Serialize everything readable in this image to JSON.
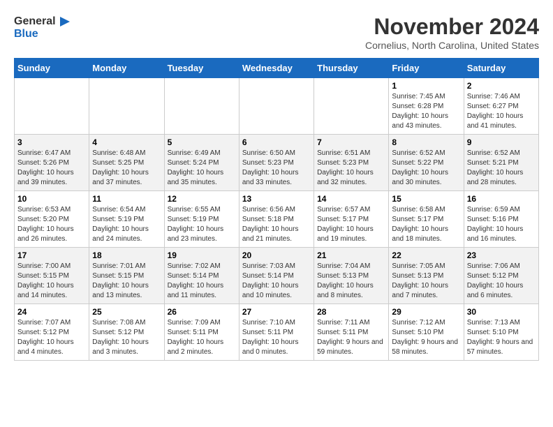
{
  "header": {
    "logo_line1": "General",
    "logo_line2": "Blue",
    "month": "November 2024",
    "location": "Cornelius, North Carolina, United States"
  },
  "days_of_week": [
    "Sunday",
    "Monday",
    "Tuesday",
    "Wednesday",
    "Thursday",
    "Friday",
    "Saturday"
  ],
  "weeks": [
    [
      {
        "day": "",
        "info": ""
      },
      {
        "day": "",
        "info": ""
      },
      {
        "day": "",
        "info": ""
      },
      {
        "day": "",
        "info": ""
      },
      {
        "day": "",
        "info": ""
      },
      {
        "day": "1",
        "info": "Sunrise: 7:45 AM\nSunset: 6:28 PM\nDaylight: 10 hours and 43 minutes."
      },
      {
        "day": "2",
        "info": "Sunrise: 7:46 AM\nSunset: 6:27 PM\nDaylight: 10 hours and 41 minutes."
      }
    ],
    [
      {
        "day": "3",
        "info": "Sunrise: 6:47 AM\nSunset: 5:26 PM\nDaylight: 10 hours and 39 minutes."
      },
      {
        "day": "4",
        "info": "Sunrise: 6:48 AM\nSunset: 5:25 PM\nDaylight: 10 hours and 37 minutes."
      },
      {
        "day": "5",
        "info": "Sunrise: 6:49 AM\nSunset: 5:24 PM\nDaylight: 10 hours and 35 minutes."
      },
      {
        "day": "6",
        "info": "Sunrise: 6:50 AM\nSunset: 5:23 PM\nDaylight: 10 hours and 33 minutes."
      },
      {
        "day": "7",
        "info": "Sunrise: 6:51 AM\nSunset: 5:23 PM\nDaylight: 10 hours and 32 minutes."
      },
      {
        "day": "8",
        "info": "Sunrise: 6:52 AM\nSunset: 5:22 PM\nDaylight: 10 hours and 30 minutes."
      },
      {
        "day": "9",
        "info": "Sunrise: 6:52 AM\nSunset: 5:21 PM\nDaylight: 10 hours and 28 minutes."
      }
    ],
    [
      {
        "day": "10",
        "info": "Sunrise: 6:53 AM\nSunset: 5:20 PM\nDaylight: 10 hours and 26 minutes."
      },
      {
        "day": "11",
        "info": "Sunrise: 6:54 AM\nSunset: 5:19 PM\nDaylight: 10 hours and 24 minutes."
      },
      {
        "day": "12",
        "info": "Sunrise: 6:55 AM\nSunset: 5:19 PM\nDaylight: 10 hours and 23 minutes."
      },
      {
        "day": "13",
        "info": "Sunrise: 6:56 AM\nSunset: 5:18 PM\nDaylight: 10 hours and 21 minutes."
      },
      {
        "day": "14",
        "info": "Sunrise: 6:57 AM\nSunset: 5:17 PM\nDaylight: 10 hours and 19 minutes."
      },
      {
        "day": "15",
        "info": "Sunrise: 6:58 AM\nSunset: 5:17 PM\nDaylight: 10 hours and 18 minutes."
      },
      {
        "day": "16",
        "info": "Sunrise: 6:59 AM\nSunset: 5:16 PM\nDaylight: 10 hours and 16 minutes."
      }
    ],
    [
      {
        "day": "17",
        "info": "Sunrise: 7:00 AM\nSunset: 5:15 PM\nDaylight: 10 hours and 14 minutes."
      },
      {
        "day": "18",
        "info": "Sunrise: 7:01 AM\nSunset: 5:15 PM\nDaylight: 10 hours and 13 minutes."
      },
      {
        "day": "19",
        "info": "Sunrise: 7:02 AM\nSunset: 5:14 PM\nDaylight: 10 hours and 11 minutes."
      },
      {
        "day": "20",
        "info": "Sunrise: 7:03 AM\nSunset: 5:14 PM\nDaylight: 10 hours and 10 minutes."
      },
      {
        "day": "21",
        "info": "Sunrise: 7:04 AM\nSunset: 5:13 PM\nDaylight: 10 hours and 8 minutes."
      },
      {
        "day": "22",
        "info": "Sunrise: 7:05 AM\nSunset: 5:13 PM\nDaylight: 10 hours and 7 minutes."
      },
      {
        "day": "23",
        "info": "Sunrise: 7:06 AM\nSunset: 5:12 PM\nDaylight: 10 hours and 6 minutes."
      }
    ],
    [
      {
        "day": "24",
        "info": "Sunrise: 7:07 AM\nSunset: 5:12 PM\nDaylight: 10 hours and 4 minutes."
      },
      {
        "day": "25",
        "info": "Sunrise: 7:08 AM\nSunset: 5:12 PM\nDaylight: 10 hours and 3 minutes."
      },
      {
        "day": "26",
        "info": "Sunrise: 7:09 AM\nSunset: 5:11 PM\nDaylight: 10 hours and 2 minutes."
      },
      {
        "day": "27",
        "info": "Sunrise: 7:10 AM\nSunset: 5:11 PM\nDaylight: 10 hours and 0 minutes."
      },
      {
        "day": "28",
        "info": "Sunrise: 7:11 AM\nSunset: 5:11 PM\nDaylight: 9 hours and 59 minutes."
      },
      {
        "day": "29",
        "info": "Sunrise: 7:12 AM\nSunset: 5:10 PM\nDaylight: 9 hours and 58 minutes."
      },
      {
        "day": "30",
        "info": "Sunrise: 7:13 AM\nSunset: 5:10 PM\nDaylight: 9 hours and 57 minutes."
      }
    ]
  ]
}
